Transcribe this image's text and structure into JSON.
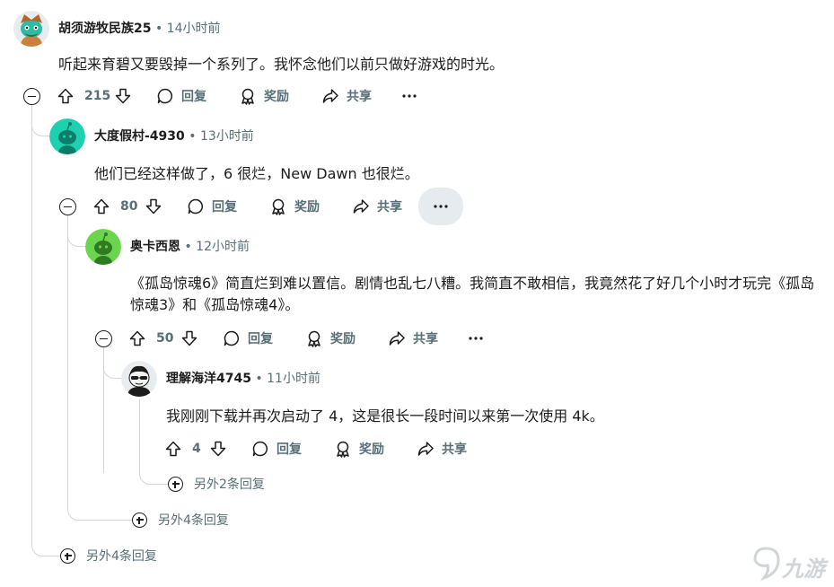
{
  "comments": [
    {
      "username": "胡须游牧民族25",
      "separator": "•",
      "time": "14小时前",
      "text": "听起来育碧又要毁掉一个系列了。我怀念他们以前只做好游戏的时光。",
      "votes": "215",
      "reply_label": "回复",
      "award_label": "奖励",
      "share_label": "共享"
    },
    {
      "username": "大度假村-4930",
      "separator": "•",
      "time": "13小时前",
      "text": "他们已经这样做了，6 很烂，New Dawn 也很烂。",
      "votes": "80",
      "reply_label": "回复",
      "award_label": "奖励",
      "share_label": "共享"
    },
    {
      "username": "奥卡西恩",
      "separator": "•",
      "time": "12小时前",
      "text": "《孤岛惊魂6》简直烂到难以置信。剧情也乱七八糟。我简直不敢相信，我竟然花了好几个小时才玩完《孤岛惊魂3》和《孤岛惊魂4》。",
      "votes": "50",
      "reply_label": "回复",
      "award_label": "奖励",
      "share_label": "共享"
    },
    {
      "username": "理解海洋4745",
      "separator": "•",
      "time": "11小时前",
      "text": "我刚刚下载并再次启动了 4，这是很长一段时间以来第一次使用 4k。",
      "votes": "4",
      "reply_label": "回复",
      "award_label": "奖励",
      "share_label": "共享"
    }
  ],
  "more_replies": [
    "另外2条回复",
    "另外4条回复",
    "另外4条回复"
  ],
  "colors": {
    "text": "#1c1c1c",
    "meta": "#576f76",
    "thread_line": "#d4d7d9",
    "avatar_teal": "#1fd0b0",
    "avatar_green": "#6bd54e",
    "active_button_bg": "#e5ebee"
  },
  "watermark": "九游"
}
